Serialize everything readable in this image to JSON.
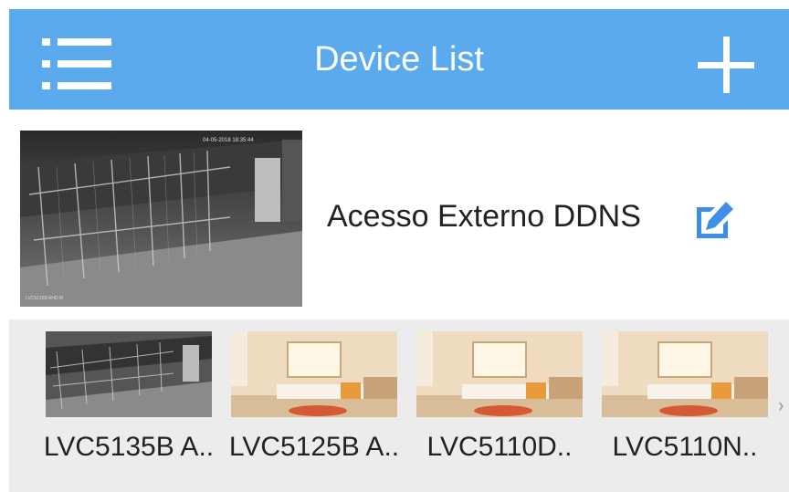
{
  "header": {
    "title": "Device List",
    "menu_icon": "menu-list-icon",
    "add_icon": "plus-icon",
    "background": "#5aaaed"
  },
  "device": {
    "name": "Acesso Externo DDNS",
    "edit_icon": "edit-icon",
    "edit_color": "#3c8ee8",
    "thumbnail_timestamp": "04-05-2018 18:35:44",
    "thumbnail_camera_label": "LVC5135B AHD-M"
  },
  "channels": [
    {
      "label": "LVC5135B A..",
      "scene": "night-camera"
    },
    {
      "label": "LVC5125B A..",
      "scene": "bedroom"
    },
    {
      "label": "LVC5110D..",
      "scene": "bedroom"
    },
    {
      "label": "LVC5110N..",
      "scene": "bedroom"
    }
  ],
  "more_icon": "chevron-right-icon"
}
